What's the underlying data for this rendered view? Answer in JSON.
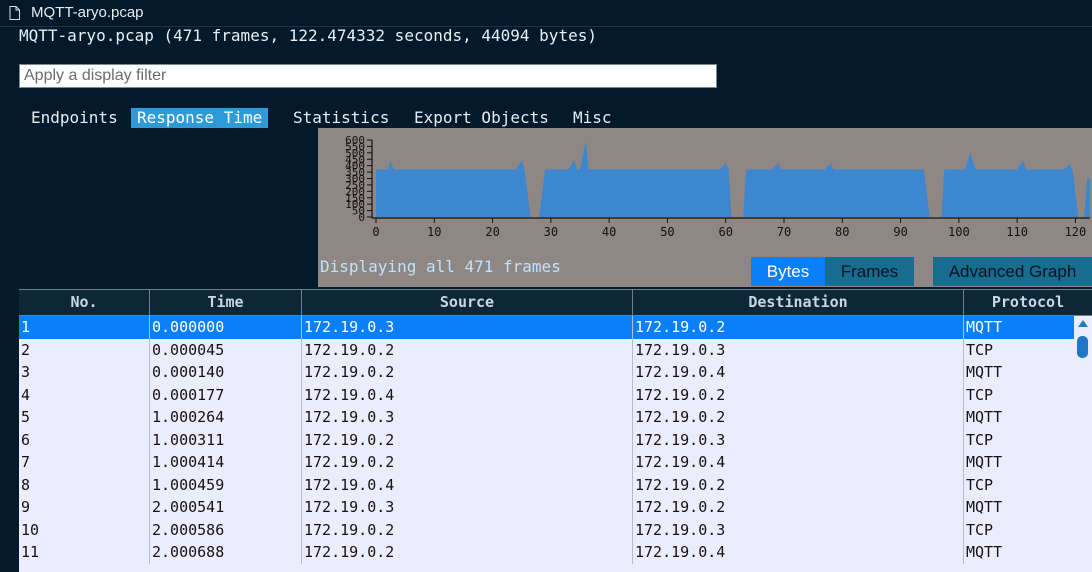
{
  "window": {
    "tab_title": "MQTT-aryo.pcap",
    "tab_icon": "file-icon"
  },
  "summary": "MQTT-aryo.pcap (471 frames, 122.474332 seconds, 44094 bytes)",
  "filter": {
    "placeholder": "Apply a display filter",
    "value": ""
  },
  "nav": {
    "items": [
      {
        "label": "Endpoints",
        "active": false
      },
      {
        "label": "Response Time",
        "active": true
      },
      {
        "label": "Statistics",
        "active": false
      },
      {
        "label": "Export Objects",
        "active": false
      },
      {
        "label": "Misc",
        "active": false
      }
    ]
  },
  "chart_data": {
    "type": "area",
    "x_ticks": [
      0,
      10,
      20,
      30,
      40,
      50,
      60,
      70,
      80,
      90,
      100,
      110,
      120
    ],
    "y_ticks": [
      0,
      50,
      100,
      150,
      200,
      250,
      300,
      350,
      400,
      450,
      500,
      550,
      600
    ],
    "xlim": [
      0,
      122.5
    ],
    "ylim": [
      0,
      600
    ],
    "color": "#3d87d1",
    "points": [
      [
        0,
        370
      ],
      [
        1,
        370
      ],
      [
        2,
        370
      ],
      [
        2.5,
        440
      ],
      [
        3,
        370
      ],
      [
        24,
        370
      ],
      [
        25,
        440
      ],
      [
        25.5,
        370
      ],
      [
        26.5,
        0
      ],
      [
        28,
        0
      ],
      [
        29,
        370
      ],
      [
        33,
        370
      ],
      [
        34,
        440
      ],
      [
        34.5,
        370
      ],
      [
        35,
        370
      ],
      [
        36,
        590
      ],
      [
        36.5,
        370
      ],
      [
        59,
        370
      ],
      [
        60,
        420
      ],
      [
        60.5,
        370
      ],
      [
        61,
        0
      ],
      [
        63,
        0
      ],
      [
        63.5,
        370
      ],
      [
        68,
        370
      ],
      [
        69,
        420
      ],
      [
        69.5,
        370
      ],
      [
        77,
        370
      ],
      [
        78,
        420
      ],
      [
        78.5,
        370
      ],
      [
        94,
        370
      ],
      [
        95,
        0
      ],
      [
        97,
        0
      ],
      [
        97.5,
        370
      ],
      [
        101,
        370
      ],
      [
        102,
        500
      ],
      [
        102.5,
        420
      ],
      [
        103,
        370
      ],
      [
        110,
        370
      ],
      [
        111,
        440
      ],
      [
        111.5,
        370
      ],
      [
        118,
        370
      ],
      [
        119,
        410
      ],
      [
        119.5,
        370
      ],
      [
        120.5,
        0
      ],
      [
        121.5,
        0
      ],
      [
        122,
        300
      ],
      [
        122.5,
        300
      ]
    ]
  },
  "chart_status": "Displaying all 471 frames",
  "buttons": {
    "bytes": "Bytes",
    "frames": "Frames",
    "advanced": "Advanced Graph"
  },
  "table": {
    "columns": [
      "No.",
      "Time",
      "Source",
      "Destination",
      "Protocol"
    ],
    "rows": [
      [
        "1",
        "0.000000",
        "172.19.0.3",
        "172.19.0.2",
        "MQTT"
      ],
      [
        "2",
        "0.000045",
        "172.19.0.2",
        "172.19.0.3",
        "TCP"
      ],
      [
        "3",
        "0.000140",
        "172.19.0.2",
        "172.19.0.4",
        "MQTT"
      ],
      [
        "4",
        "0.000177",
        "172.19.0.4",
        "172.19.0.2",
        "TCP"
      ],
      [
        "5",
        "1.000264",
        "172.19.0.3",
        "172.19.0.2",
        "MQTT"
      ],
      [
        "6",
        "1.000311",
        "172.19.0.2",
        "172.19.0.3",
        "TCP"
      ],
      [
        "7",
        "1.000414",
        "172.19.0.2",
        "172.19.0.4",
        "MQTT"
      ],
      [
        "8",
        "1.000459",
        "172.19.0.4",
        "172.19.0.2",
        "TCP"
      ],
      [
        "9",
        "2.000541",
        "172.19.0.3",
        "172.19.0.2",
        "MQTT"
      ],
      [
        "10",
        "2.000586",
        "172.19.0.2",
        "172.19.0.3",
        "TCP"
      ],
      [
        "11",
        "2.000688",
        "172.19.0.2",
        "172.19.0.4",
        "MQTT"
      ]
    ],
    "selected_row": 0
  }
}
